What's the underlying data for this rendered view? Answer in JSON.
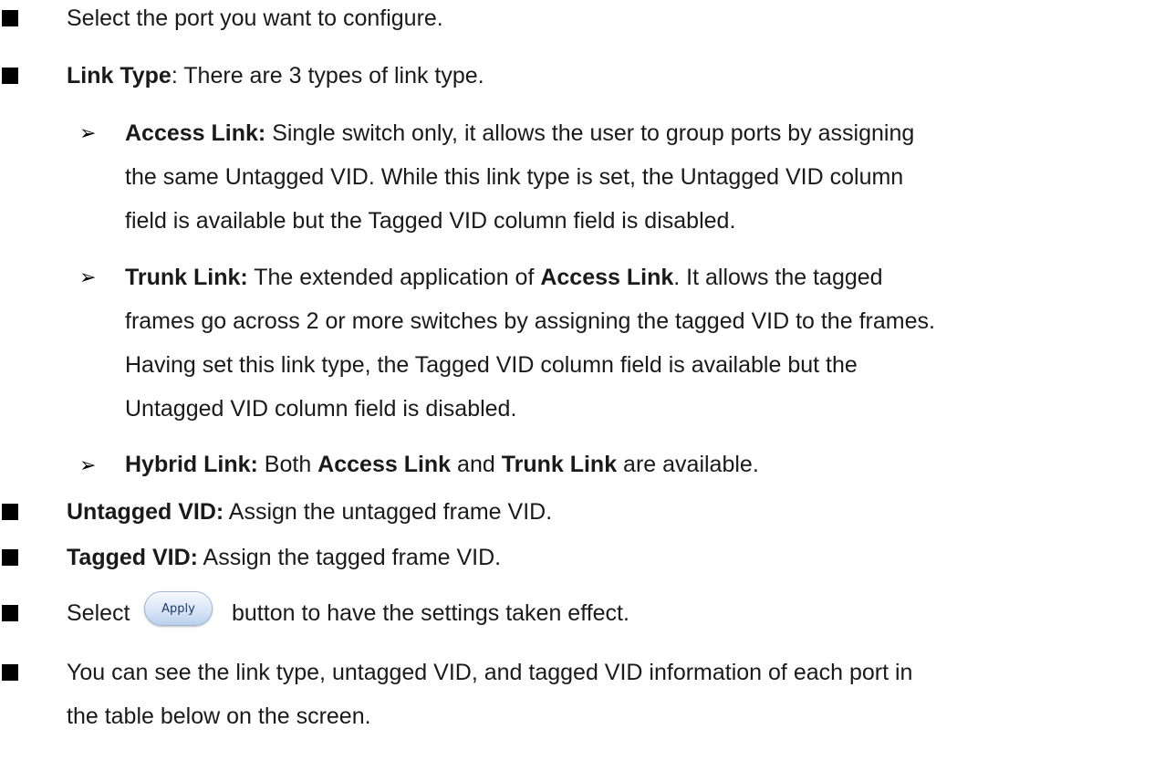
{
  "bullets": {
    "select_port": "Select the port you want to configure.",
    "link_type_label": "Link Type",
    "link_type_text": ": There are 3 types of link type.",
    "access": {
      "label": "Access Link:",
      "line1": " Single switch only, it allows the user to group ports by assigning",
      "line2": "the same Untagged VID. While this link type is set, the Untagged VID column",
      "line3": "field is available but the Tagged VID column field is disabled."
    },
    "trunk": {
      "label": "Trunk Link:",
      "line1_a": " The extended application of ",
      "line1_bold": "Access Link",
      "line1_b": ". It allows the tagged",
      "line2": "frames go across 2 or more switches by assigning the tagged VID to the frames.",
      "line3": "Having set this link type, the Tagged VID column field is available but the",
      "line4": "Untagged VID column field is disabled."
    },
    "hybrid": {
      "label": "Hybrid Link:",
      "text_a": " Both ",
      "bold_a": "Access Link",
      "text_b": " and ",
      "bold_b": "Trunk Link",
      "text_c": " are available."
    },
    "untagged": {
      "label": "Untagged VID:",
      "text": " Assign the untagged frame VID."
    },
    "tagged": {
      "label": "Tagged VID:",
      "text": " Assign the tagged frame VID."
    },
    "apply_row": {
      "before": "Select",
      "button_label": "Apply",
      "after": "button to have the settings taken effect."
    },
    "info": {
      "line1": "You can see the link type, untagged VID, and tagged VID information of each port in",
      "line2": "the table below on the screen."
    }
  },
  "icons": {
    "square_bullet": "square-bullet-icon",
    "arrow_bullet": "arrow-bullet-icon"
  }
}
